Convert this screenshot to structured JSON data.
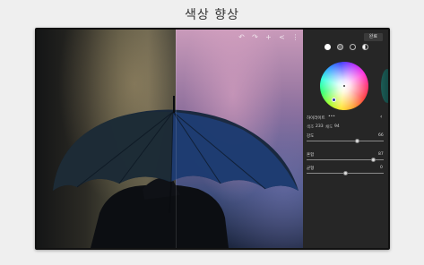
{
  "page": {
    "title": "색상 향상"
  },
  "toolbar": {
    "icons": [
      "undo-icon",
      "redo-icon",
      "add-icon",
      "share-icon",
      "more-icon"
    ],
    "glyphs": [
      "↶",
      "↷",
      "+",
      "<",
      "⋮"
    ]
  },
  "panel": {
    "save_label": "완료",
    "section_label": "하이라이트",
    "section_more": "•••",
    "hue_label": "색조",
    "hue_value": "233",
    "sat_label": "채도",
    "sat_value": "94",
    "strength_label": "강도",
    "strength_value": "66",
    "blend_label": "혼합",
    "blend_value": "87",
    "balance_label": "균형",
    "balance_value": "0",
    "chevron": "‹"
  },
  "levels": {
    "strength": 0.66,
    "blend": 0.87,
    "balance": 0.5
  }
}
